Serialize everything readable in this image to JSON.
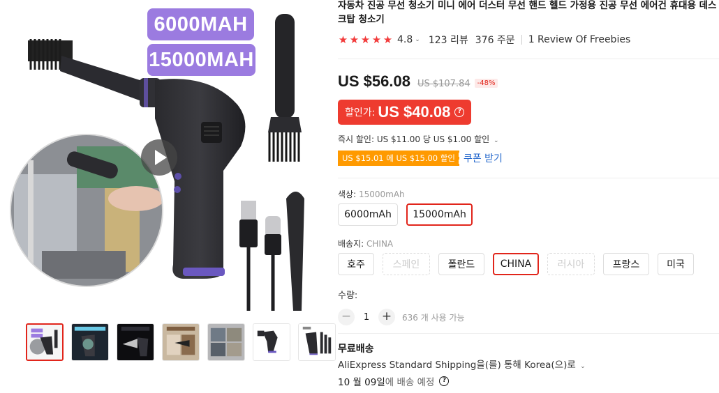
{
  "gallery": {
    "badge_top": "6000MAH",
    "badge_bottom": "15000MAH",
    "thumbnails": [
      {
        "name": "thumb-1",
        "active": true
      },
      {
        "name": "thumb-2",
        "active": false
      },
      {
        "name": "thumb-3",
        "active": false
      },
      {
        "name": "thumb-4",
        "active": false
      },
      {
        "name": "thumb-5",
        "active": false
      },
      {
        "name": "thumb-6",
        "active": false
      },
      {
        "name": "thumb-7",
        "active": false
      }
    ]
  },
  "product": {
    "title": "자동차 진공 무선 청소기 미니 에어 더스터 무선 핸드 헬드 가정용 진공 무선 에어건 휴대용 데스크탑 청소기",
    "rating": "4.8",
    "reviews": "123 리뷰",
    "orders": "376 주문",
    "freebies": "1 Review Of Freebies",
    "price_now": "US $56.08",
    "price_old": "US $107.84",
    "discount": "-48%",
    "sale_label": "할인가:",
    "sale_price": "US $40.08",
    "instant_discount": "즉시 할인: US $11.00 당 US $1.00 할인",
    "coupon_tag": "US $15.01 에 US $15.00 할인",
    "coupon_link": "쿠폰 받기"
  },
  "color": {
    "label": "색상:",
    "selected": "15000mAh",
    "options": [
      "6000mAh",
      "15000mAh"
    ]
  },
  "ship_from": {
    "label": "배송지:",
    "selected": "CHINA",
    "options": [
      "호주",
      "스페인",
      "폴란드",
      "CHINA",
      "러시아",
      "프랑스",
      "미국"
    ]
  },
  "quantity": {
    "label": "수량:",
    "minus": "−",
    "plus": "+",
    "value": "1",
    "available": "636 개 사용 가능"
  },
  "shipping": {
    "title": "무료배송",
    "method": "AliExpress Standard Shipping을(를) 통해 Korea(으)로",
    "date": "10 월 09일",
    "date_suffix": "에 배송 예정"
  },
  "colors": {
    "accent_red": "#e1251b",
    "sale_bg": "#ee3b2f",
    "coupon_bg": "#ff9a00",
    "link_blue": "#2266cc",
    "badge_purple": "#9b7be0"
  }
}
